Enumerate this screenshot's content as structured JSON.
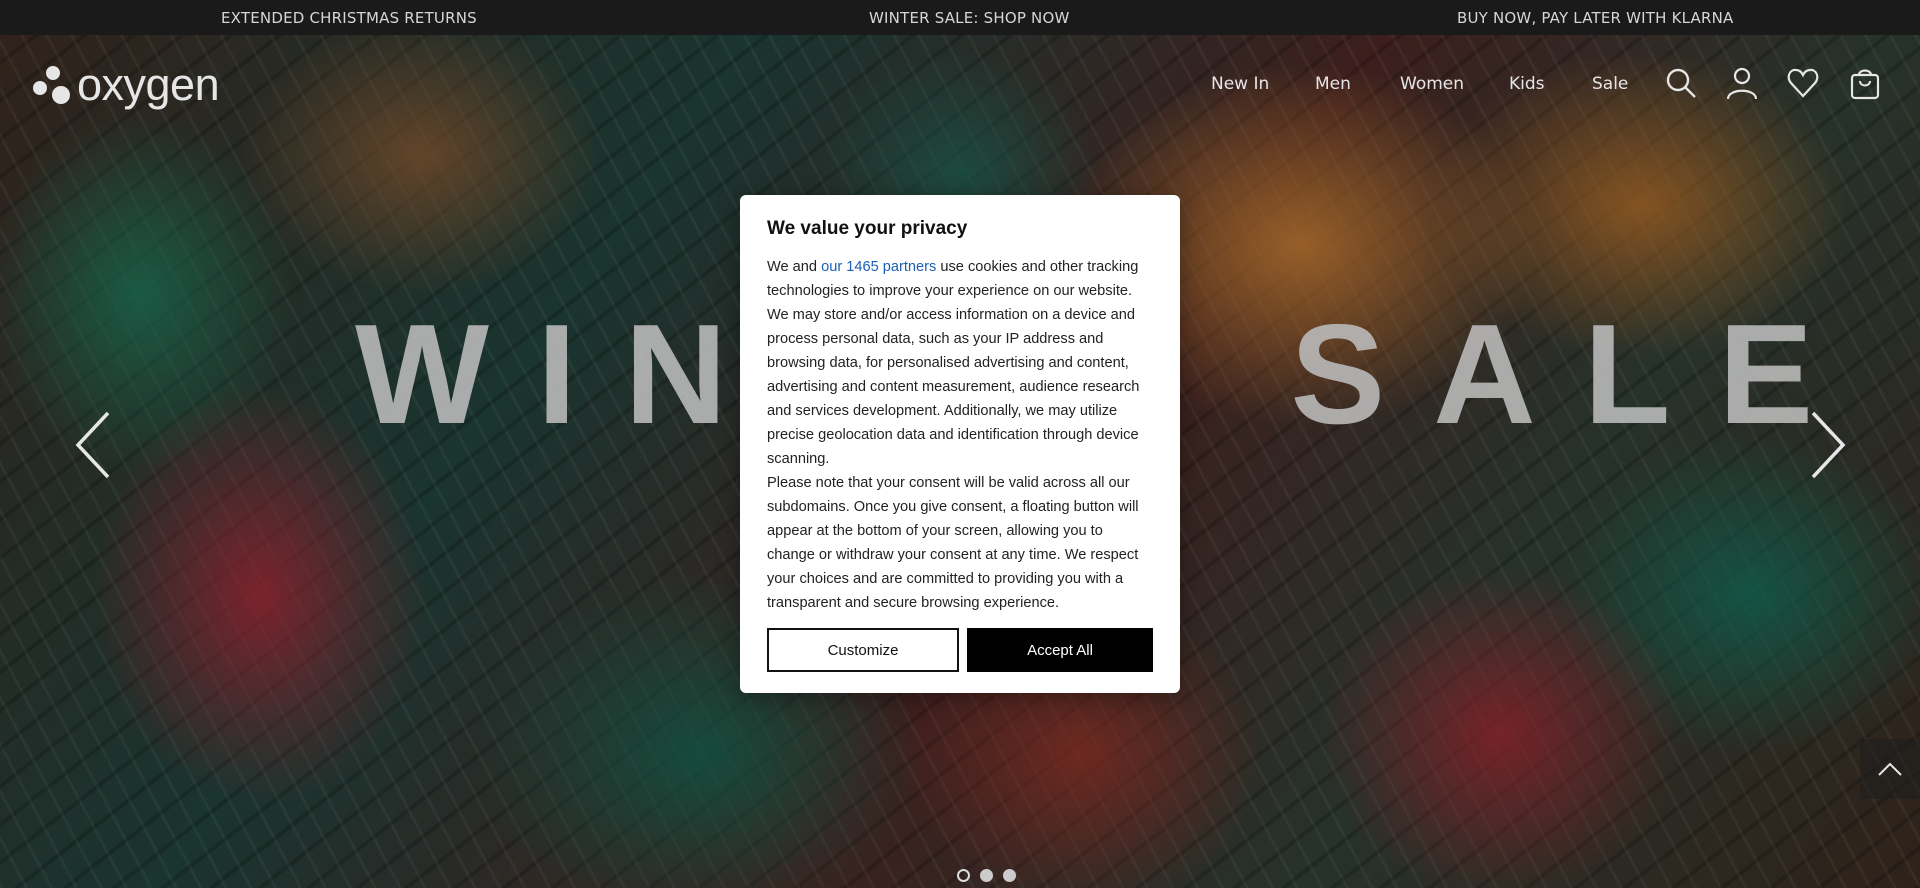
{
  "promo_bar": {
    "left": "EXTENDED CHRISTMAS RETURNS",
    "center": "WINTER SALE: SHOP NOW",
    "right": "BUY NOW, PAY LATER WITH KLARNA"
  },
  "header": {
    "logo_text": "oxygen",
    "nav": [
      "New In",
      "Men",
      "Women",
      "Kids",
      "Sale"
    ],
    "icons": [
      "search-icon",
      "account-icon",
      "wishlist-icon",
      "cart-icon"
    ]
  },
  "hero": {
    "title": "WINTER SALE",
    "slide_count": 3,
    "active_slide": 1
  },
  "consent": {
    "title": "We value your privacy",
    "body_prefix": "We and ",
    "body_link": "our 1465 partners",
    "body_suffix": " use cookies and other tracking technologies to improve your experience on our website. We may store and/or access information on a device and process personal data, such as your IP address and browsing data, for personalised advertising and content, advertising and content measurement, audience research and services development. Additionally, we may utilize precise geolocation data and identification through device scanning.",
    "body_second": "Please note that your consent will be valid across all our subdomains. Once you give consent, a floating button will appear at the bottom of your screen, allowing you to change or withdraw your consent at any time. We respect your choices and are committed to providing you with a transparent and secure browsing experience.",
    "customize_label": "Customize",
    "accept_label": "Accept All"
  },
  "colors": {
    "promo_bg": "#1a1a1a",
    "link": "#1a5fb4",
    "accept_bg": "#000000"
  }
}
